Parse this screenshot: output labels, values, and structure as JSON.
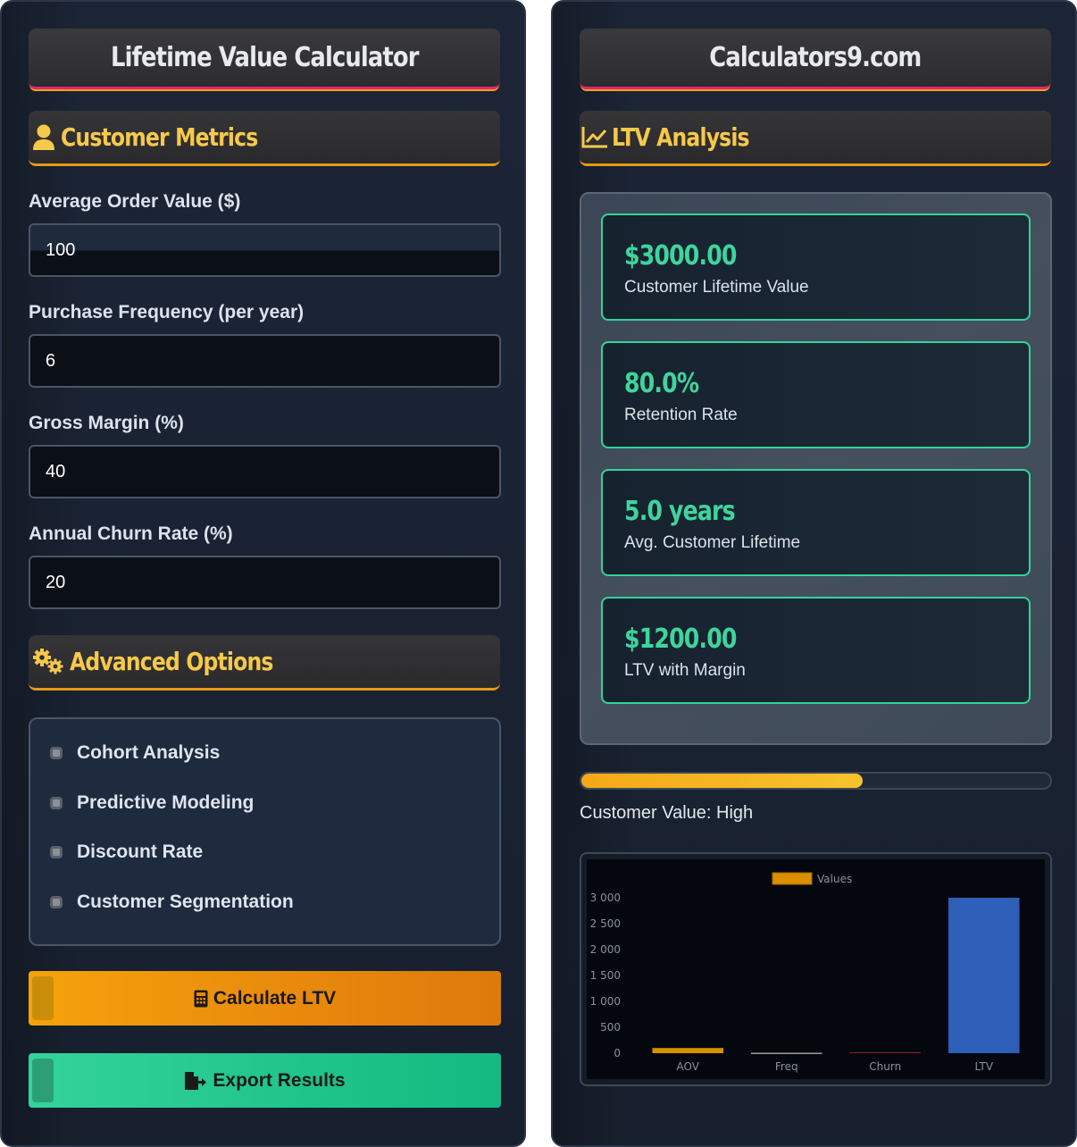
{
  "left": {
    "title": "Lifetime Value Calculator",
    "metrics_section": {
      "title": "Customer Metrics",
      "icon": "user-icon"
    },
    "fields": [
      {
        "label": "Average Order Value ($)",
        "value": "100"
      },
      {
        "label": "Purchase Frequency (per year)",
        "value": "6"
      },
      {
        "label": "Gross Margin (%)",
        "value": "40"
      },
      {
        "label": "Annual Churn Rate (%)",
        "value": "20"
      }
    ],
    "advanced_section": {
      "title": "Advanced Options",
      "icon": "gears-icon"
    },
    "options": [
      {
        "label": "Cohort Analysis",
        "checked": false
      },
      {
        "label": "Predictive Modeling",
        "checked": false
      },
      {
        "label": "Discount Rate",
        "checked": false
      },
      {
        "label": "Customer Segmentation",
        "checked": false
      }
    ],
    "calculate_button": {
      "label": "Calculate LTV",
      "icon": "calculator-icon",
      "color": "#f5a20c"
    },
    "export_button": {
      "label": "Export Results",
      "icon": "file-export-icon",
      "color": "#1fc48a"
    }
  },
  "right": {
    "title": "Calculators9.com",
    "analysis_section": {
      "title": "LTV Analysis",
      "icon": "chart-line-icon"
    },
    "results": [
      {
        "value": "$3000.00",
        "label": "Customer Lifetime Value"
      },
      {
        "value": "80.0%",
        "label": "Retention Rate"
      },
      {
        "value": "5.0 years",
        "label": "Avg. Customer Lifetime"
      },
      {
        "value": "$1200.00",
        "label": "LTV with Margin"
      }
    ],
    "progress": {
      "fraction": 0.6,
      "label": "Customer Value: High"
    },
    "colors": {
      "accent": "#f6c94a",
      "result": "#3ed59c",
      "border_pink": "#e0266f"
    }
  },
  "chart_data": {
    "type": "bar",
    "categories": [
      "AOV",
      "Freq",
      "Churn",
      "LTV"
    ],
    "series": [
      {
        "name": "Values",
        "values": [
          100,
          6,
          20,
          3000
        ]
      }
    ],
    "bar_colors": [
      "#d98f00",
      "#e8e8e8",
      "#8b1c2c",
      "#2d5fb8"
    ],
    "legend_color": "#d98f00",
    "yticks": [
      "0",
      "500",
      "1 000",
      "1 500",
      "2 000",
      "2 500",
      "3 000"
    ],
    "ylim": [
      0,
      3000
    ],
    "legend_position": "top-center",
    "grid": false
  }
}
